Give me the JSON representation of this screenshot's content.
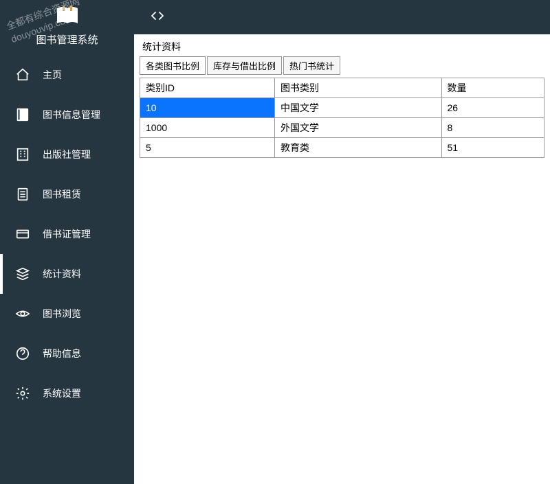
{
  "brand": {
    "title": "图书管理系统"
  },
  "watermark": {
    "line1": "全都有综合资源网",
    "line2": "douyouvip.com"
  },
  "sidebar": {
    "items": [
      {
        "label": "主页",
        "icon": "home"
      },
      {
        "label": "图书信息管理",
        "icon": "book"
      },
      {
        "label": "出版社管理",
        "icon": "building"
      },
      {
        "label": "图书租赁",
        "icon": "document"
      },
      {
        "label": "借书证管理",
        "icon": "card"
      },
      {
        "label": "统计资料",
        "icon": "stack",
        "active": true
      },
      {
        "label": "图书浏览",
        "icon": "eye"
      },
      {
        "label": "帮助信息",
        "icon": "help"
      },
      {
        "label": "系统设置",
        "icon": "gear"
      }
    ]
  },
  "main": {
    "panelTitle": "统计资料",
    "tabs": [
      {
        "label": "各类图书比例",
        "active": true
      },
      {
        "label": "库存与借出比例"
      },
      {
        "label": "热门书统计"
      }
    ],
    "table": {
      "headers": [
        "类别ID",
        "图书类别",
        "数量"
      ],
      "rows": [
        {
          "cells": [
            "10",
            "中国文学",
            "26"
          ],
          "selected": true
        },
        {
          "cells": [
            "1000",
            "外国文学",
            "8"
          ]
        },
        {
          "cells": [
            "5",
            "教育类",
            "51"
          ]
        }
      ]
    }
  }
}
